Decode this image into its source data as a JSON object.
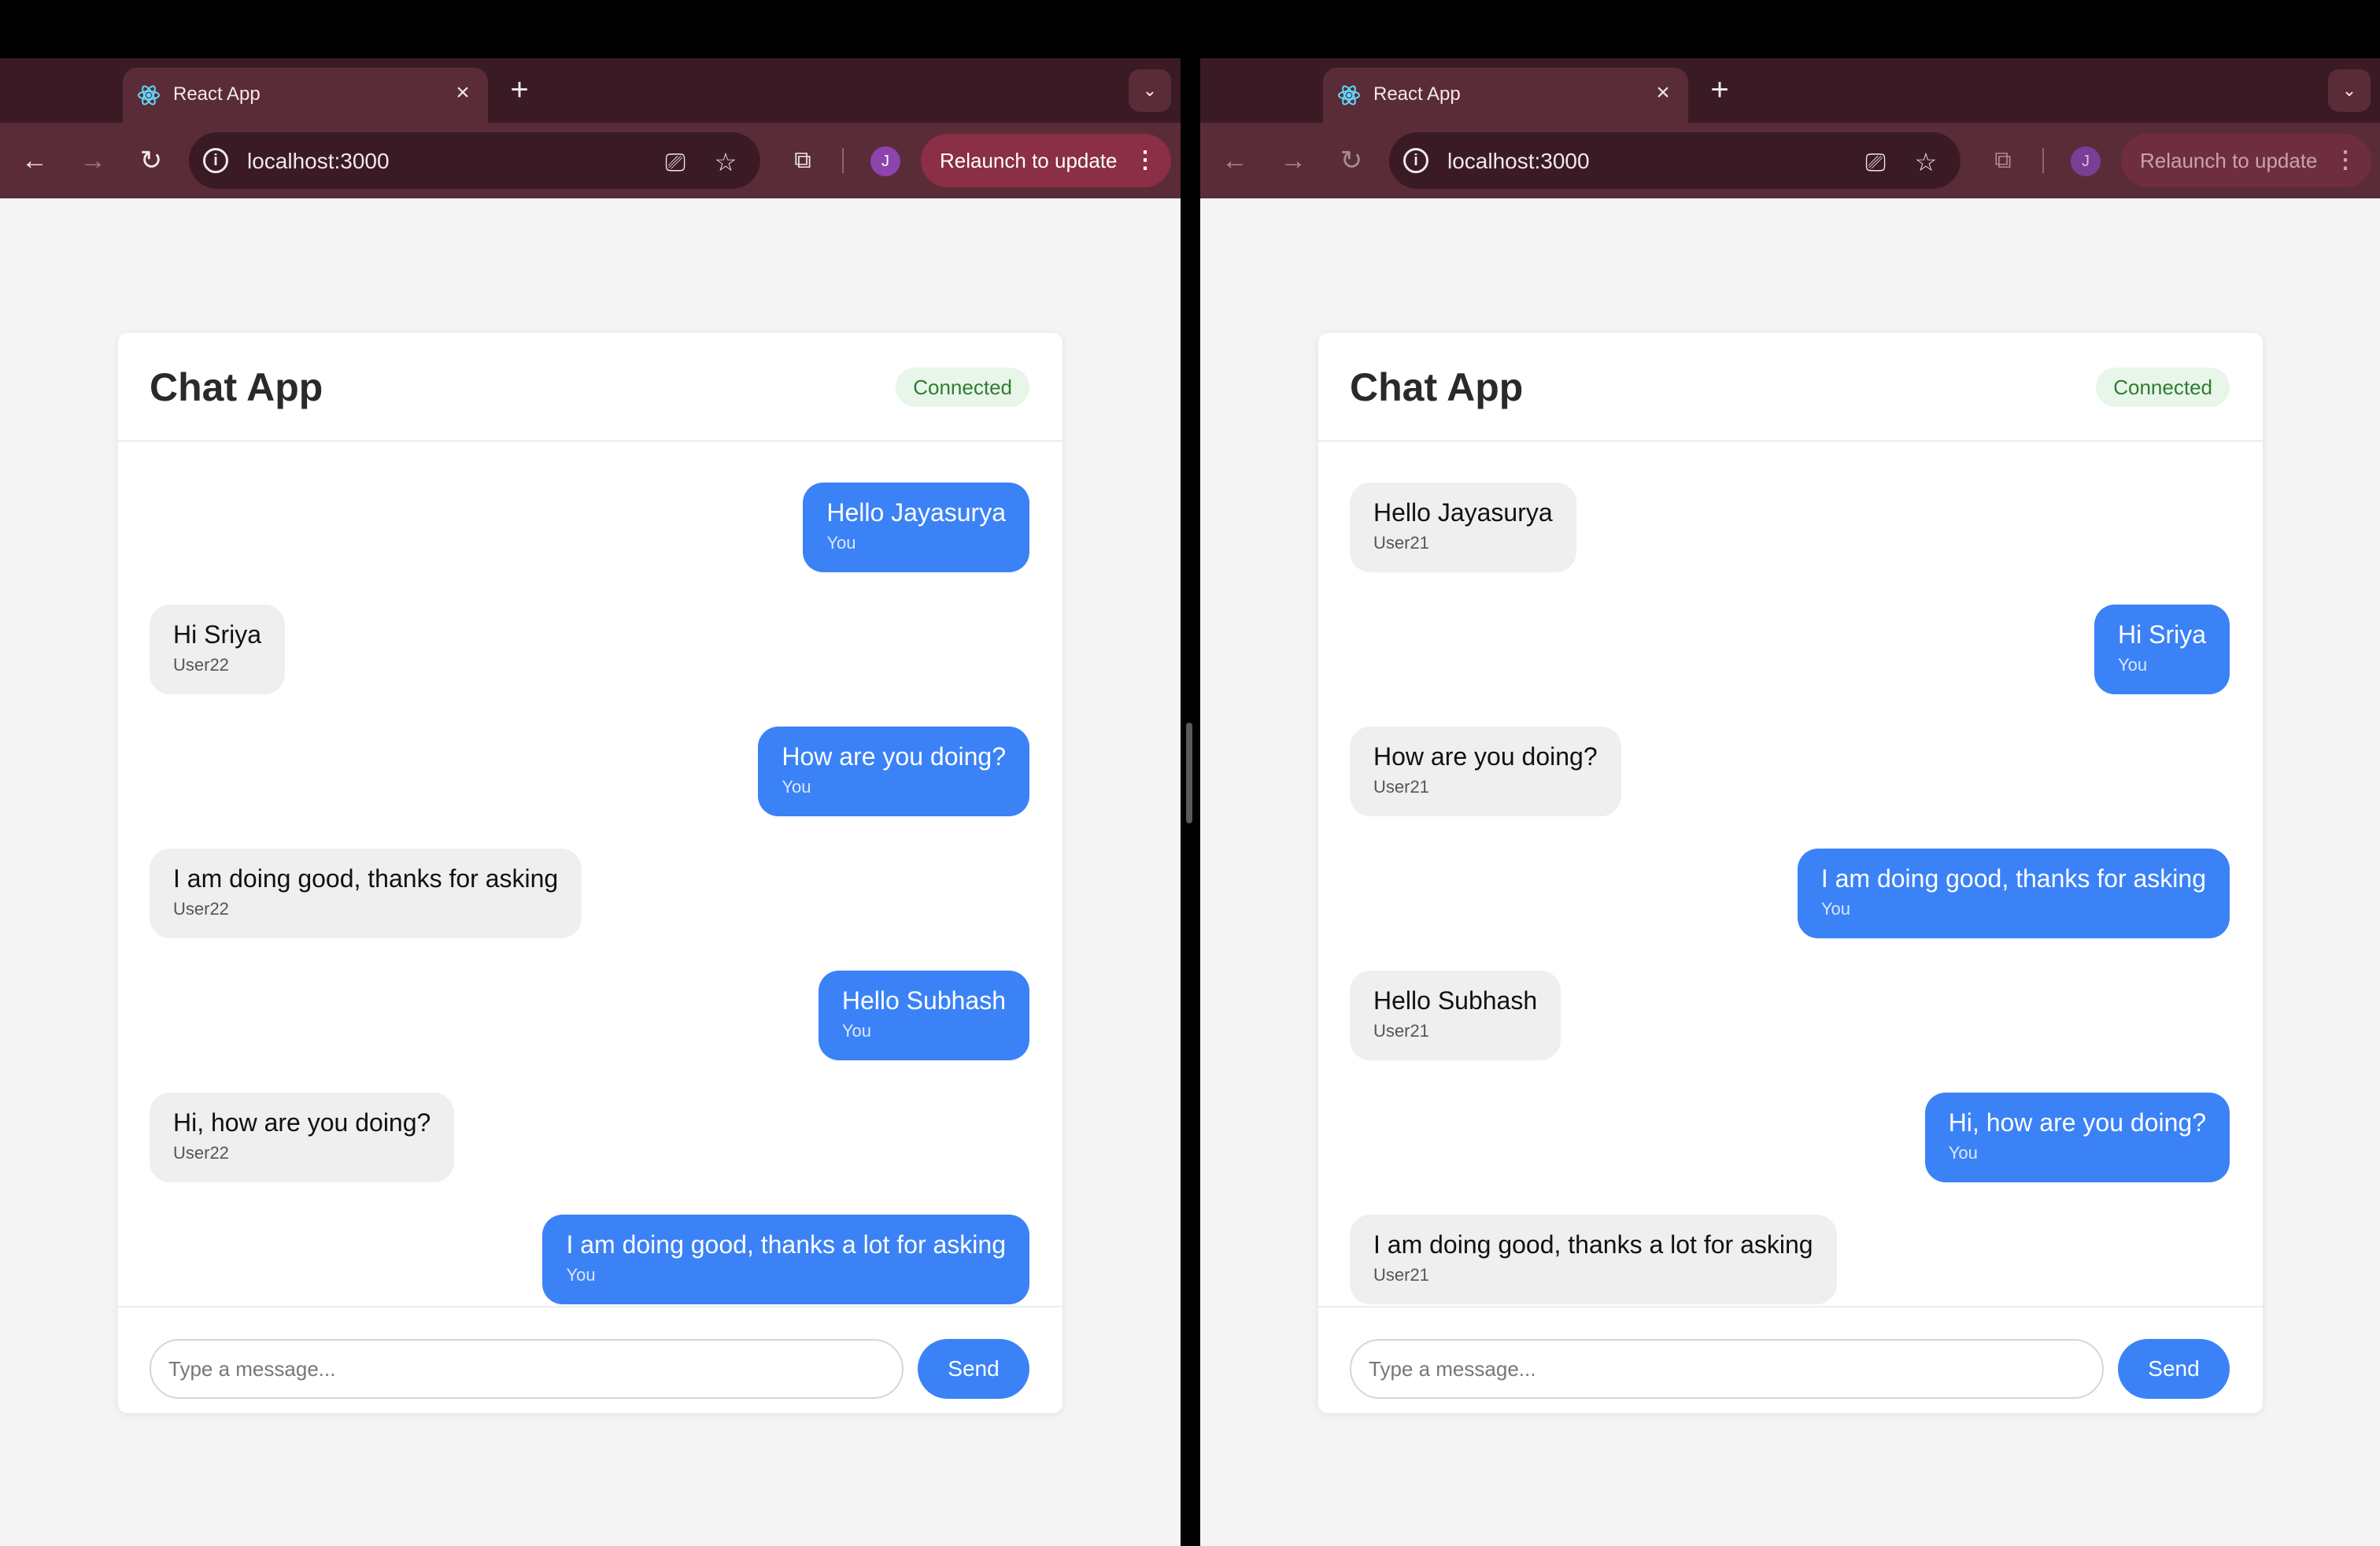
{
  "browser": {
    "tab_title": "React App",
    "url": "localhost:3000",
    "profile_initial": "J",
    "relaunch_label": "Relaunch to update"
  },
  "chat": {
    "title": "Chat App",
    "status": "Connected",
    "input_placeholder": "Type a message...",
    "send_label": "Send"
  },
  "windows": [
    {
      "messages": [
        {
          "text": "Hello Jayasurya",
          "user": "You",
          "side": "sent"
        },
        {
          "text": "Hi Sriya",
          "user": "User22",
          "side": "recv"
        },
        {
          "text": "How are you doing?",
          "user": "You",
          "side": "sent"
        },
        {
          "text": "I am doing good, thanks for asking",
          "user": "User22",
          "side": "recv"
        },
        {
          "text": "Hello Subhash",
          "user": "You",
          "side": "sent"
        },
        {
          "text": "Hi, how are you doing?",
          "user": "User22",
          "side": "recv"
        },
        {
          "text": "I am doing good, thanks a lot for asking",
          "user": "You",
          "side": "sent"
        }
      ]
    },
    {
      "messages": [
        {
          "text": "Hello Jayasurya",
          "user": "User21",
          "side": "recv"
        },
        {
          "text": "Hi Sriya",
          "user": "You",
          "side": "sent"
        },
        {
          "text": "How are you doing?",
          "user": "User21",
          "side": "recv"
        },
        {
          "text": "I am doing good, thanks for asking",
          "user": "You",
          "side": "sent"
        },
        {
          "text": "Hello Subhash",
          "user": "User21",
          "side": "recv"
        },
        {
          "text": "Hi, how are you doing?",
          "user": "You",
          "side": "sent"
        },
        {
          "text": "I am doing good, thanks a lot for asking",
          "user": "User21",
          "side": "recv"
        }
      ]
    }
  ]
}
